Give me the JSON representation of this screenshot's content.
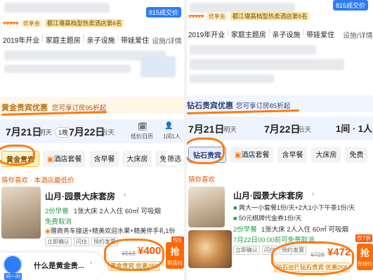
{
  "left": {
    "top_chip": "815成交价",
    "vip_label": "优享会",
    "rank_label": "都江堰高档型热卖酒店第6名",
    "features": [
      "2019年开业",
      "家庭主题房",
      "亲子设施",
      "带娃爱住"
    ],
    "facilities_link": "设施/详情",
    "banner_title": "黄金贵宾优惠",
    "banner_sub": "您可享订房95折起",
    "checkin_date": "7月21日",
    "checkin_week": "明天",
    "nights": "1晚",
    "checkout_date": "7月22日",
    "checkout_week": "后天",
    "calendar_label": "低价日历",
    "guests_label": "1间1人",
    "filters": [
      "黄金贵宾",
      "酒店套餐",
      "含早餐",
      "大床房",
      "免费",
      "筛选"
    ],
    "section_title": "猜你喜欢 · 本酒店最低价",
    "room": {
      "name": "山月·园景大床套房",
      "breakfast": "2份早餐",
      "specs": "1张大床  2人入住  60㎡  可吸烟",
      "free_cancel": "免费取消",
      "perks": "赠商务车接送+精美欢迎水果+精美伴手礼1份",
      "tags": [
        "立即确认",
        "闪住",
        "预约发票"
      ],
      "orig_price": "¥668",
      "price": "¥400",
      "discount": "黄金贵宾 优惠268",
      "book_label": "抢",
      "book_sub": "到店付",
      "corner_badge": "仅6折"
    },
    "chat_bubble": "什么是黄金贵...",
    "chat_label": "问一问"
  },
  "right": {
    "top_chip": "815成交价",
    "vip_label": "优享会",
    "rank_label": "都江堰高档型热卖酒店第6名",
    "features": [
      "2019年开业",
      "家庭主题房",
      "亲子设施",
      "带娃爱住"
    ],
    "facilities_link": "设施/详情",
    "banner_title": "钻石贵宾优惠",
    "banner_sub": "您可享订房85折起",
    "checkin_date": "7月21日",
    "checkin_week": "明天",
    "checkout_date": "7月22日",
    "checkout_week": "后天",
    "guests_label": "1间 · 1人",
    "filters": [
      "钻石贵宾",
      "酒店套餐",
      "含早餐",
      "大床房",
      "免费"
    ],
    "section_title": "猜你喜欢",
    "room": {
      "name": "山月·园景大床套房",
      "perk1": "两大一小套餐1份/天+2大1小下午茶1份/天",
      "perk2": "50元棋牌代金券1份/天",
      "breakfast": "2份早餐",
      "specs": "1张大床  2人入住  60㎡  可吸烟",
      "cancel_note": "7月22日00:00前可免费取消",
      "tags": [
        "立即确认",
        "闪住",
        "预约发票"
      ],
      "orig_price": "¥728",
      "price": "¥472",
      "discount_tier": "钻石出行",
      "discount": "钻石贵宾 优惠256",
      "book_label": "抢",
      "book_sub": "在线付",
      "corner_badge": "仅7折"
    }
  }
}
